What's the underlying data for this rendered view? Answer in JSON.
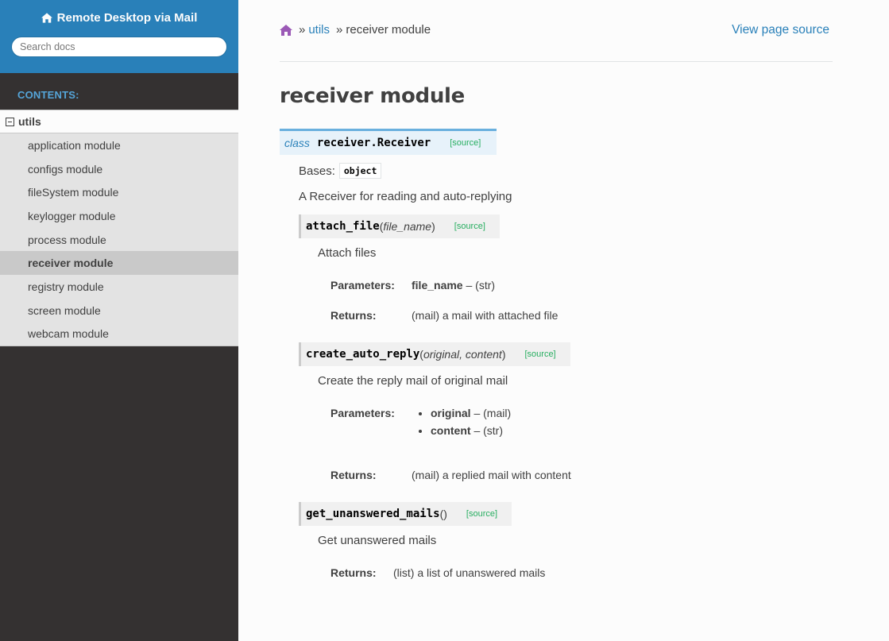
{
  "sidebar": {
    "project_title": "Remote Desktop via Mail",
    "search_placeholder": "Search docs",
    "caption": "Contents:",
    "top_item": "utils",
    "items": [
      {
        "label": "application module"
      },
      {
        "label": "configs module"
      },
      {
        "label": "fileSystem module"
      },
      {
        "label": "keylogger module"
      },
      {
        "label": "process module"
      },
      {
        "label": "receiver module",
        "active": true
      },
      {
        "label": "registry module"
      },
      {
        "label": "screen module"
      },
      {
        "label": "webcam module"
      }
    ]
  },
  "breadcrumb": {
    "sep": "»",
    "parent": "utils",
    "current": "receiver module",
    "view_source": "View page source"
  },
  "page": {
    "title": "receiver module",
    "class_keyword": "class",
    "class_name": "receiver.Receiver",
    "source_label": "[source]",
    "bases_label": "Bases:",
    "bases_value": "object",
    "class_desc": "A Receiver for reading and auto-replying",
    "methods": [
      {
        "name": "attach_file",
        "open": "(",
        "params": "file_name",
        "close": ")",
        "desc": "Attach files",
        "params_label": "Parameters:",
        "param_name": "file_name",
        "param_type": " – (str)",
        "returns_label": "Returns:",
        "returns": "(mail) a mail with attached file"
      },
      {
        "name": "create_auto_reply",
        "open": "(",
        "params": "original, content",
        "close": ")",
        "desc": "Create the reply mail of original mail",
        "params_label": "Parameters:",
        "param_list": [
          {
            "name": "original",
            "type": " – (mail)"
          },
          {
            "name": "content",
            "type": " – (str)"
          }
        ],
        "returns_label": "Returns:",
        "returns": "(mail) a replied mail with content"
      },
      {
        "name": "get_unanswered_mails",
        "open": "(",
        "params": "",
        "close": ")",
        "desc": "Get unanswered mails",
        "returns_label": "Returns:",
        "returns": "(list) a list of unanswered mails"
      }
    ]
  },
  "colors": {
    "sidebar_top": "#2980b9",
    "sidebar_bg": "#343131",
    "link": "#2980b9",
    "source_link": "#27ae60",
    "home_icon": "#9b59b6"
  },
  "icons": {
    "project": "home-icon",
    "breadcrumb_home": "home-icon",
    "toggle": "collapse-toggle-icon"
  }
}
